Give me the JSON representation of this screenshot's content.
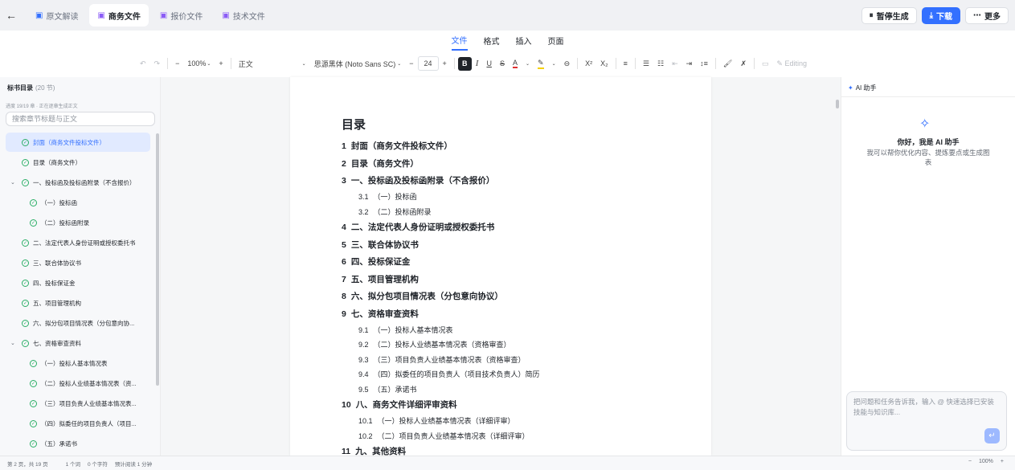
{
  "app": {
    "back_icon": "←"
  },
  "tabs": [
    {
      "label": "原文解读",
      "active": false,
      "color": "blue"
    },
    {
      "label": "商务文件",
      "active": true,
      "color": "purple"
    },
    {
      "label": "报价文件",
      "active": false,
      "color": "purple"
    },
    {
      "label": "技术文件",
      "active": false,
      "color": "purple"
    }
  ],
  "top_actions": {
    "pause": "暂停生成",
    "download": "下载",
    "more": "更多"
  },
  "menu": [
    {
      "label": "文件",
      "active": true
    },
    {
      "label": "格式",
      "active": false
    },
    {
      "label": "插入",
      "active": false
    },
    {
      "label": "页面",
      "active": false
    }
  ],
  "toolbar": {
    "zoom": "100%",
    "style": "正文",
    "font": "思源黑体 (Noto Sans SC)",
    "size": "24",
    "editing": "Editing"
  },
  "outline": {
    "title": "标书目录",
    "count": "(20 节)",
    "progress": "进度 19/19 章 · 正在逐章生成正文",
    "search_placeholder": "搜索章节标题与正文",
    "items": [
      {
        "label": "封面（商务文件投标文件）",
        "level": 0,
        "active": true
      },
      {
        "label": "目录（商务文件）",
        "level": 0
      },
      {
        "label": "一、投标函及投标函附录（不含报价）",
        "level": 0,
        "caret": "⌄"
      },
      {
        "label": "（一）投标函",
        "level": 1
      },
      {
        "label": "（二）投标函附录",
        "level": 1
      },
      {
        "label": "二、法定代表人身份证明或授权委托书",
        "level": 0
      },
      {
        "label": "三、联合体协议书",
        "level": 0
      },
      {
        "label": "四、投标保证金",
        "level": 0
      },
      {
        "label": "五、项目管理机构",
        "level": 0
      },
      {
        "label": "六、拟分包项目情况表（分包意向协...",
        "level": 0
      },
      {
        "label": "七、资格审查资料",
        "level": 0,
        "caret": "⌄"
      },
      {
        "label": "（一）投标人基本情况表",
        "level": 1
      },
      {
        "label": "（二）投标人业绩基本情况表（资...",
        "level": 1
      },
      {
        "label": "（三）项目负责人业绩基本情况表...",
        "level": 1
      },
      {
        "label": "（四）拟委任的项目负责人（项目...",
        "level": 1
      },
      {
        "label": "（五）承诺书",
        "level": 1
      }
    ]
  },
  "document": {
    "title": "目录",
    "toc": [
      {
        "num": "1",
        "text": "封面（商务文件投标文件）",
        "level": 1
      },
      {
        "num": "2",
        "text": "目录（商务文件）",
        "level": 1
      },
      {
        "num": "3",
        "text": "一、投标函及投标函附录（不含报价）",
        "level": 1
      },
      {
        "num": "3.1",
        "text": "（一）投标函",
        "level": 2
      },
      {
        "num": "3.2",
        "text": "（二）投标函附录",
        "level": 2
      },
      {
        "num": "4",
        "text": "二、法定代表人身份证明或授权委托书",
        "level": 1
      },
      {
        "num": "5",
        "text": "三、联合体协议书",
        "level": 1
      },
      {
        "num": "6",
        "text": "四、投标保证金",
        "level": 1
      },
      {
        "num": "7",
        "text": "五、项目管理机构",
        "level": 1
      },
      {
        "num": "8",
        "text": "六、拟分包项目情况表（分包意向协议）",
        "level": 1
      },
      {
        "num": "9",
        "text": "七、资格审查资料",
        "level": 1
      },
      {
        "num": "9.1",
        "text": "（一）投标人基本情况表",
        "level": 2
      },
      {
        "num": "9.2",
        "text": "（二）投标人业绩基本情况表（资格审查）",
        "level": 2
      },
      {
        "num": "9.3",
        "text": "（三）项目负责人业绩基本情况表（资格审查）",
        "level": 2
      },
      {
        "num": "9.4",
        "text": "（四）拟委任的项目负责人（项目技术负责人）简历",
        "level": 2
      },
      {
        "num": "9.5",
        "text": "（五）承诺书",
        "level": 2
      },
      {
        "num": "10",
        "text": "八、商务文件详细评审资料",
        "level": 1
      },
      {
        "num": "10.1",
        "text": "（一）投标人业绩基本情况表（详细评审）",
        "level": 2
      },
      {
        "num": "10.2",
        "text": "（二）项目负责人业绩基本情况表（详细评审）",
        "level": 2
      },
      {
        "num": "11",
        "text": "九、其他资料",
        "level": 1
      }
    ]
  },
  "assistant": {
    "title": "AI 助手",
    "greeting": "你好，我是 AI 助手",
    "subtitle": "我可以帮你优化内容、提炼要点或生成图表",
    "input_placeholder": "把问题和任务告诉我，输入 @ 快速选择已安装技能与知识库..."
  },
  "status": {
    "page": "第 2 页，共 19 页",
    "words": "1 个词",
    "chars": "0 个字符",
    "reading": "预计阅读 1 分钟",
    "zoom": "100%"
  }
}
